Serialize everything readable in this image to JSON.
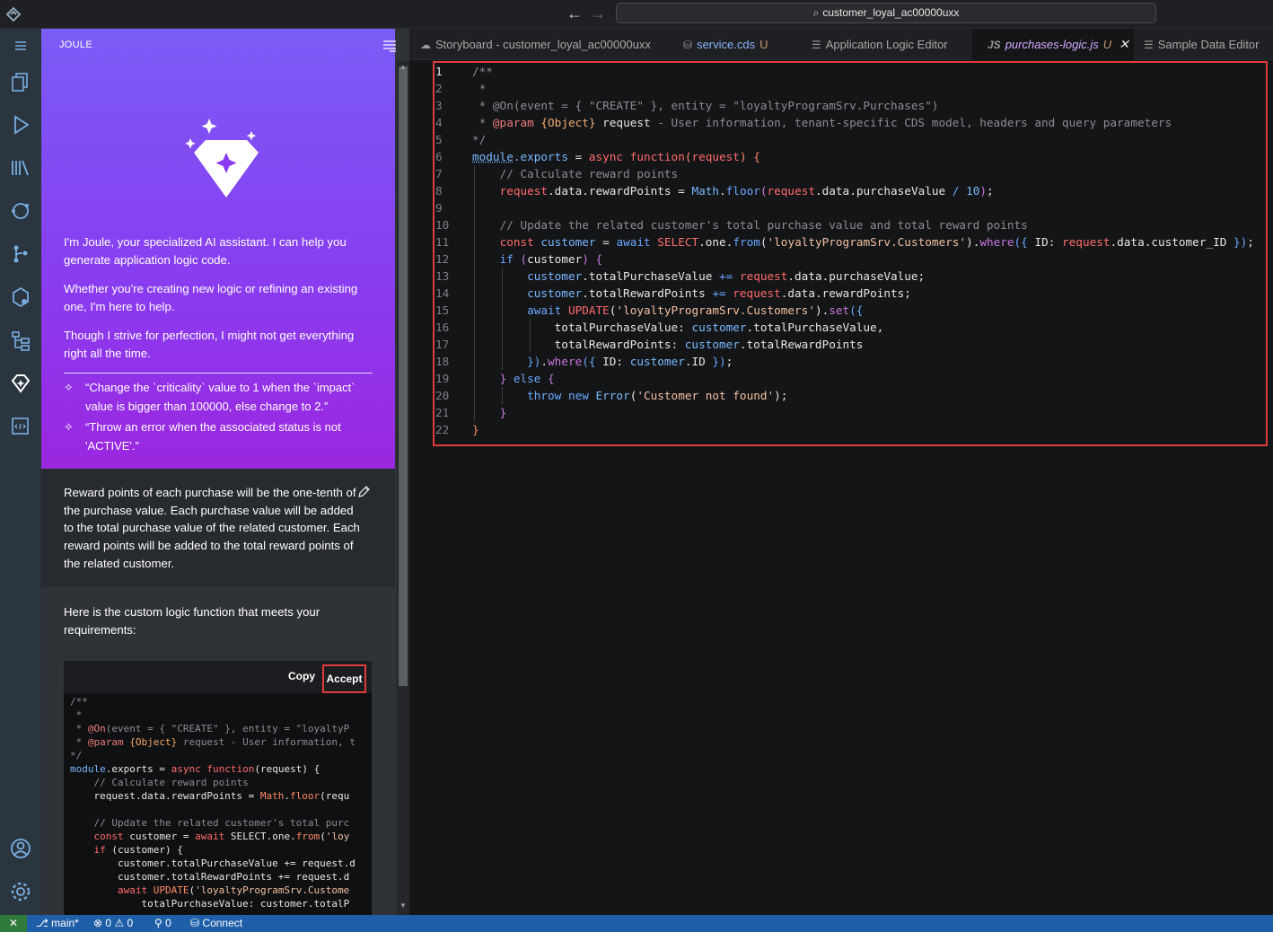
{
  "titlebar": {
    "search_text": "customer_loyal_ac00000uxx"
  },
  "activity_bar": {
    "items": [
      "menu-icon",
      "explorer-icon",
      "run-icon",
      "library-icon",
      "cloud-icon",
      "source-control-icon",
      "deploy-icon",
      "storyboard-icon",
      "joule-icon",
      "code-review-icon",
      "account-icon",
      "settings-icon"
    ]
  },
  "joule": {
    "title": "JOULE",
    "intro_1": "I'm Joule, your specialized AI assistant. I can help you generate application logic code.",
    "intro_2": "Whether you're creating new logic or refining an existing one, I'm here to help.",
    "intro_3": "Though I strive for perfection, I might not get everything right all the time.",
    "suggestion_1": "“Change the `criticality` value to 1 when the `impact` value is bigger than 100000, else change to 2.”",
    "suggestion_2": "“Throw an error when the associated status is not 'ACTIVE'.”",
    "user_message": "Reward points of each purchase will be the one-tenth of the purchase value. Each purchase value will be added to the total purchase value of the related customer. Each reward points will be added to the total reward points of the related customer.",
    "bot_message": "Here is the custom logic function that meets your requirements:",
    "copy_label": "Copy",
    "accept_label": "Accept"
  },
  "tabs": [
    {
      "label": "Storyboard - customer_loyal_ac00000uxx",
      "icon": "cloud-icon",
      "suffix": ""
    },
    {
      "label": "service.cds",
      "icon": "cds-icon",
      "suffix": "U"
    },
    {
      "label": "Application Logic Editor",
      "icon": "doc-icon",
      "suffix": ""
    },
    {
      "label": "purchases-logic.js",
      "icon": "JS",
      "suffix": "U"
    },
    {
      "label": "Sample Data Editor",
      "icon": "doc-icon",
      "suffix": ""
    }
  ],
  "editor": {
    "line_numbers": [
      "1",
      "2",
      "3",
      "4",
      "5",
      "6",
      "7",
      "8",
      "9",
      "10",
      "11",
      "12",
      "13",
      "14",
      "15",
      "16",
      "17",
      "18",
      "19",
      "20",
      "21",
      "22"
    ]
  },
  "statusbar": {
    "branch": "main*",
    "errors": "0",
    "warnings": "0",
    "ports": "0",
    "connect": "Connect"
  },
  "colors": {
    "accent_red": "#e03c3c",
    "joule_gradient_top": "#7a5cf6",
    "joule_gradient_bottom": "#9b27de",
    "statusbar": "#1f5fa8"
  }
}
